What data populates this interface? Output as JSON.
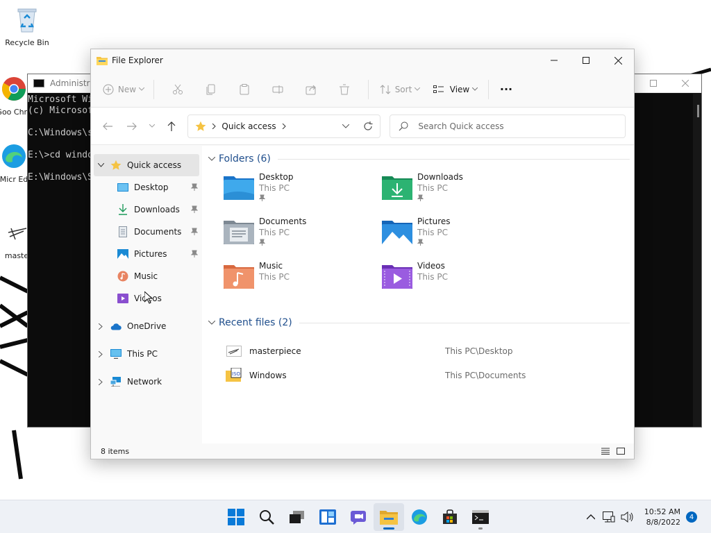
{
  "desktop": {
    "recycle_bin": "Recycle Bin",
    "chrome_label": "Goo Chro",
    "edge_label": "Micr Ed",
    "masterpiece_label": "maste"
  },
  "cmd": {
    "title": "Administrat",
    "lines": [
      "Microsoft Wi",
      "(c) Microsof",
      "",
      "C:\\Windows\\s",
      "",
      "E:\\>cd windo",
      "",
      "E:\\Windows\\S"
    ]
  },
  "explorer": {
    "title": "File Explorer",
    "toolbar": {
      "new": "New",
      "sort": "Sort",
      "view": "View",
      "more": "···"
    },
    "address": {
      "location": "Quick access"
    },
    "search": {
      "placeholder": "Search Quick access"
    },
    "sidebar": {
      "quick_access": "Quick access",
      "items": [
        "Desktop",
        "Downloads",
        "Documents",
        "Pictures",
        "Music",
        "Videos"
      ],
      "onedrive": "OneDrive",
      "this_pc": "This PC",
      "network": "Network"
    },
    "folders_header": "Folders (6)",
    "folders": [
      {
        "name": "Desktop",
        "location": "This PC"
      },
      {
        "name": "Downloads",
        "location": "This PC"
      },
      {
        "name": "Documents",
        "location": "This PC"
      },
      {
        "name": "Pictures",
        "location": "This PC"
      },
      {
        "name": "Music",
        "location": "This PC"
      },
      {
        "name": "Videos",
        "location": "This PC"
      }
    ],
    "recent_header": "Recent files (2)",
    "recent": [
      {
        "name": "masterpiece",
        "path": "This PC\\Desktop"
      },
      {
        "name": "Windows",
        "path": "This PC\\Documents"
      }
    ],
    "status": "8 items"
  },
  "taskbar": {
    "time": "10:52 AM",
    "date": "8/8/2022",
    "notifications": "4"
  },
  "colors": {
    "accent": "#0067c0",
    "folder_yellow": "#f5c343",
    "header_blue": "#1f4e8c"
  }
}
